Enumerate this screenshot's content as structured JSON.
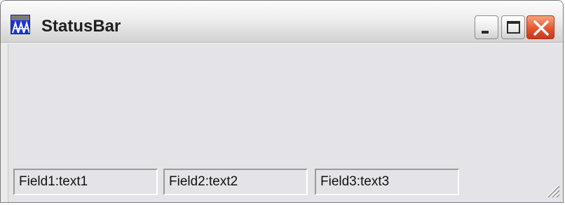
{
  "window": {
    "title": "StatusBar",
    "icon": "app-icon",
    "controls": [
      "minimize-icon",
      "maximize-icon",
      "close-icon"
    ]
  },
  "status_bar": {
    "fields": [
      {
        "text": "Field1:text1"
      },
      {
        "text": "Field2:text2"
      },
      {
        "text": "Field3:text3"
      }
    ]
  },
  "colors": {
    "client_background": "#e4e3e7",
    "close_button": "#e7572e",
    "icon_blue": "#1b36d8"
  }
}
